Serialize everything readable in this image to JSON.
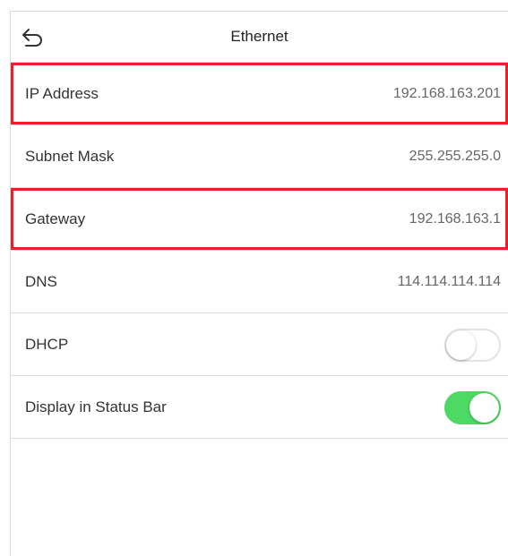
{
  "header": {
    "back_icon": "back-arrow-icon",
    "title": "Ethernet"
  },
  "rows": [
    {
      "label": "IP Address",
      "value": "192.168.163.201",
      "highlighted": true
    },
    {
      "label": "Subnet Mask",
      "value": "255.255.255.0",
      "highlighted": false
    },
    {
      "label": "Gateway",
      "value": "192.168.163.1",
      "highlighted": true
    },
    {
      "label": "DNS",
      "value": "114.114.114.114",
      "highlighted": false
    }
  ],
  "toggles": [
    {
      "label": "DHCP",
      "on": false
    },
    {
      "label": "Display in Status Bar",
      "on": true
    }
  ],
  "colors": {
    "toggle_on": "#4cd964",
    "highlight": "#e8202a"
  }
}
